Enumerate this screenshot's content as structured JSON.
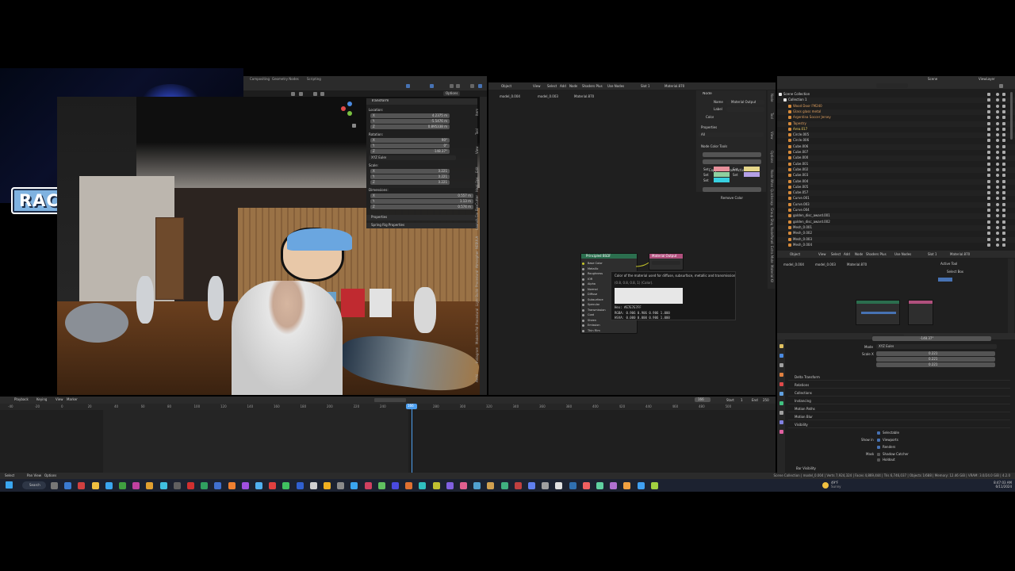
{
  "webcam": {
    "logo_text": "RACKIFX"
  },
  "top_tabs": [
    "Compositing",
    "Geometry Nodes",
    "Scripting"
  ],
  "viewport_header": {
    "options_label": "Options"
  },
  "transform_panel": {
    "title": "Transform",
    "location_label": "Location:",
    "location": [
      {
        "axis": "X",
        "value": "4.2375 m"
      },
      {
        "axis": "Y",
        "value": "-5.5476 m"
      },
      {
        "axis": "Z",
        "value": "0.895338 m"
      }
    ],
    "rotation_label": "Rotation:",
    "rotation": [
      {
        "axis": "X",
        "value": "90°"
      },
      {
        "axis": "Y",
        "value": "0°"
      },
      {
        "axis": "Z",
        "value": "-148.37°"
      }
    ],
    "rotation_mode": "XYZ Euler",
    "scale_label": "Scale:",
    "scale": [
      {
        "axis": "X",
        "value": "0.221"
      },
      {
        "axis": "Y",
        "value": "0.221"
      },
      {
        "axis": "Z",
        "value": "0.221"
      }
    ],
    "dimensions_label": "Dimensions:",
    "dimensions": [
      {
        "axis": "X",
        "value": "0.557 m"
      },
      {
        "axis": "Y",
        "value": "1.13 m"
      },
      {
        "axis": "Z",
        "value": "0.574 m"
      }
    ],
    "properties_label": "Properties",
    "spring_rig_label": "Spring Rig Properties"
  },
  "viewport_side_tabs": [
    "Item",
    "Tool",
    "View",
    "Edit",
    "Hard Ops",
    "BoxCutter",
    "Launch Control",
    "NEBULA",
    "Atmosphere",
    "Procedural Alps",
    "Light Builder",
    "Procedural Crowds",
    "Modern Path",
    "Instagram",
    "Archi"
  ],
  "node_editor": {
    "header": [
      "Object",
      "View",
      "Select",
      "Add",
      "Node",
      "Shaders Plus",
      "Use Nodes",
      "Slot 1",
      "Material.870"
    ],
    "breadcrumb": [
      "model_0.004",
      "model_0.003",
      "Material.870"
    ],
    "node_panel": {
      "title": "Node",
      "name_label": "Name",
      "name_value": "Material Output",
      "label_label": "Label",
      "color_label": "Color",
      "properties_label": "Properties",
      "properties_value": "All",
      "tools_title": "Node Color Tools",
      "random_color": "Random Color",
      "copy_color": "Copy Color From Active Node",
      "set_labels": [
        "Set",
        "Set",
        "Set",
        "Set",
        "Set"
      ],
      "remove_color": "Remove Color"
    },
    "side_tabs": [
      "Node",
      "Tool",
      "View",
      "Options",
      "Node Wrangler",
      "Quicksnap",
      "Group Shapes",
      "NodePanels",
      "Extra Material",
      "Material Kit"
    ],
    "bsdf_title": "Principled BSDF",
    "output_title": "Material Output",
    "bsdf_rows": [
      "Base Color",
      "Metallic",
      "Roughness",
      "IOR",
      "Alpha",
      "Normal",
      "Diffuse",
      "Subsurface",
      "Specular",
      "Transmission",
      "Coat",
      "Sheen",
      "Emission",
      "Thin Film"
    ],
    "tooltip": {
      "desc": "Color of the material used for diffuse, subsurface, metallic and transmission.",
      "val": "(0.8, 0.8, 0.8, 1) (Color).",
      "hex": "Hex: #E7E7E7FF",
      "rgba": "RGBA:  0.906  0.906  0.906  1.000",
      "hsva": "HSVA:  0.000  0.000  0.906  1.000"
    }
  },
  "outliner": {
    "search_placeholder": "",
    "scene_label": "Scene",
    "view_layer": "ViewLayer",
    "items": [
      "Scene Collection",
      "Collection 1",
      "Wood Door FM240",
      "Glass glass metal",
      "Argentina Soccer Jersey",
      "Tapestry",
      "Area.017",
      "Circle.005",
      "Circle.006",
      "Cube.006",
      "Cube.007",
      "Cube.000",
      "Cube.001",
      "Cube.002",
      "Cube.003",
      "Cube.004",
      "Cube.005",
      "Cube.057",
      "Curve.001",
      "Curve.003",
      "Curve.004",
      "golden_disc_award.001",
      "golden_disc_award.002",
      "Mesh_0.001",
      "Mesh_0.002",
      "Mesh_0.003",
      "Mesh_0.004"
    ]
  },
  "mini_node_editor": {
    "header": [
      "Object",
      "View",
      "Select",
      "Add",
      "Node",
      "Shaders Plus",
      "Use Nodes",
      "Slot 1",
      "Material.870"
    ],
    "breadcrumb": [
      "model_0.004",
      "model_0.003",
      "Material.870"
    ],
    "active_tool": "Active Tool",
    "select_box": "Select Box"
  },
  "properties_editor": {
    "z_value": "-148.37°",
    "mode_label": "Mode",
    "mode_value": "XYZ Euler",
    "scale_label": "Scale X",
    "scale_values": [
      "0.221",
      "0.221",
      "0.221"
    ],
    "sections": [
      "Delta Transform",
      "Relations",
      "Collections",
      "Instancing",
      "Motion Paths",
      "Motion Blur",
      "Visibility"
    ],
    "visibility": [
      "Selectable",
      "Viewports",
      "Renders",
      "Shadow Catcher",
      "Holdout"
    ],
    "show_in": "Show in",
    "mask": "Mask",
    "bottom": "Bar Visibility"
  },
  "timeline": {
    "menu": [
      "Playback",
      "Keying",
      "View",
      "Marker"
    ],
    "frame": "166",
    "start_label": "Start",
    "start": "1",
    "end_label": "End",
    "end": "250",
    "ticks": [
      "-40",
      "-20",
      "0",
      "20",
      "40",
      "60",
      "80",
      "100",
      "120",
      "140",
      "160",
      "180",
      "200",
      "220",
      "240",
      "260",
      "280",
      "300",
      "320",
      "340",
      "360",
      "380",
      "400",
      "420",
      "440",
      "460",
      "480",
      "500"
    ],
    "current": "166"
  },
  "status_bar": {
    "left": [
      "Select",
      "Pan View",
      "Options"
    ],
    "right": "Scene Collection | model_0.004 | Verts 7,924,324 | Faces 4,869,444 | Tris 6,746,037 | Objects 1/688 | Memory: 12.46 GiB | VRAM: 3.0/24.0 GiB | 4.2.0"
  },
  "taskbar": {
    "search": "Search",
    "weather_temp": "49°F",
    "weather_desc": "Sunny",
    "time": "8:47:03 AM",
    "date": "6/11/2024"
  },
  "colors": {
    "blender_bg": "#1d1d1d",
    "header": "#2b2b2b",
    "accent_blue": "#4772b3",
    "playhead": "#4ea0f0",
    "node_green": "#2b6e4e",
    "node_pink": "#b0507d"
  }
}
